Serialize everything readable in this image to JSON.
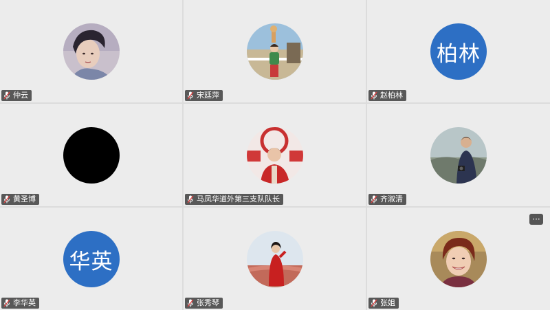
{
  "participants": [
    {
      "name": "仲云",
      "avatar_type": "photo",
      "avatar_desc": "woman-portrait-icon"
    },
    {
      "name": "宋廷萍",
      "avatar_type": "photo",
      "avatar_desc": "woman-outdoor-icon"
    },
    {
      "name": "赵柏林",
      "avatar_type": "text",
      "avatar_text": "柏林",
      "avatar_color": "#2d6fc4"
    },
    {
      "name": "黄圣博",
      "avatar_type": "blank",
      "avatar_color": "#000000"
    },
    {
      "name": "马凤华道外第三支队队长",
      "avatar_type": "photo",
      "avatar_desc": "woman-volunteer-icon"
    },
    {
      "name": "齐淑清",
      "avatar_type": "photo",
      "avatar_desc": "woman-camera-icon"
    },
    {
      "name": "李华英",
      "avatar_type": "text",
      "avatar_text": "华英",
      "avatar_color": "#2d6fc4"
    },
    {
      "name": "张秀琴",
      "avatar_type": "photo",
      "avatar_desc": "woman-red-coat-icon"
    },
    {
      "name": "张姐",
      "avatar_type": "photo",
      "avatar_desc": "woman-smiling-icon"
    }
  ],
  "more_button": {
    "label": "···"
  },
  "colors": {
    "tile_bg": "#ececec",
    "grid_bg": "#dcdcdc",
    "avatar_blue": "#2d6fc4",
    "tag_bg": "#1e1e1e"
  }
}
